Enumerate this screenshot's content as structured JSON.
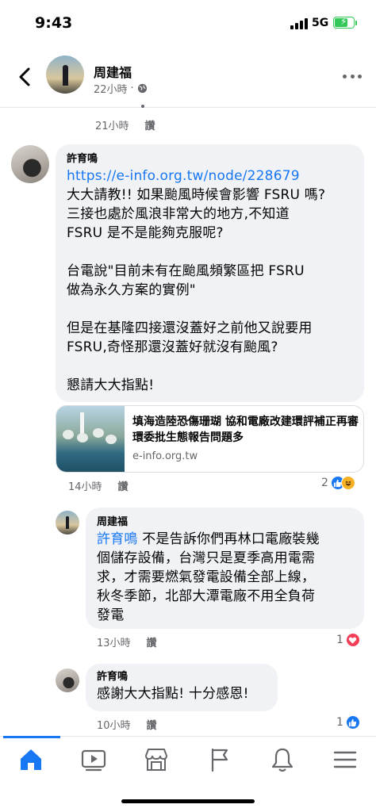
{
  "status_bar": {
    "time": "9:43",
    "network": "5G"
  },
  "header": {
    "name": "周建福",
    "time": "22小時",
    "dot": "·"
  },
  "top_meta": {
    "time": "21小時",
    "reply": "讚"
  },
  "comment1": {
    "author": "許育鳴",
    "link": "https://e-info.org.tw/node/228679",
    "body": "大大請教!! 如果颱風時候會影響 FSRU 嗎?\n三接也處於風浪非常大的地方,不知道\nFSRU 是不是能夠克服呢?\n\n台電說\"目前未有在颱風頻繁區把 FSRU\n做為永久方案的實例\"\n\n但是在基隆四接還沒蓋好之前他又說要用\nFSRU,奇怪那還沒蓋好就沒有颱風?\n\n懇請大大指點!",
    "card_title": "填海造陸恐傷珊瑚 協和電廠改建環評補正再審 環委批生態報告問題多",
    "card_domain": "e-info.org.tw",
    "time": "14小時",
    "reply": "讚",
    "reaction_count": "2"
  },
  "reply1": {
    "author": "周建福",
    "mention": "許育鳴",
    "body": " 不是告訴你們再林口電廠裝幾\n個儲存設備，台灣只是夏季高用電需\n求，才需要燃氣發電設備全部上線，\n秋冬季節，北部大潭電廠不用全負荷\n發電",
    "time": "13小時",
    "reply": "讚",
    "reaction_count": "1"
  },
  "reply2": {
    "author": "許育鳴",
    "body": "感謝大大指點! 十分感恩!",
    "time": "10小時",
    "reply": "讚",
    "reaction_count": "1"
  },
  "colors": {
    "accent": "#1877f2",
    "bubble": "#f0f2f5",
    "meta": "#65676b"
  },
  "icons": [
    "back-arrow-icon",
    "globe-icon",
    "more-icon",
    "home-icon",
    "video-icon",
    "marketplace-icon",
    "flag-icon",
    "bell-icon",
    "menu-icon"
  ]
}
